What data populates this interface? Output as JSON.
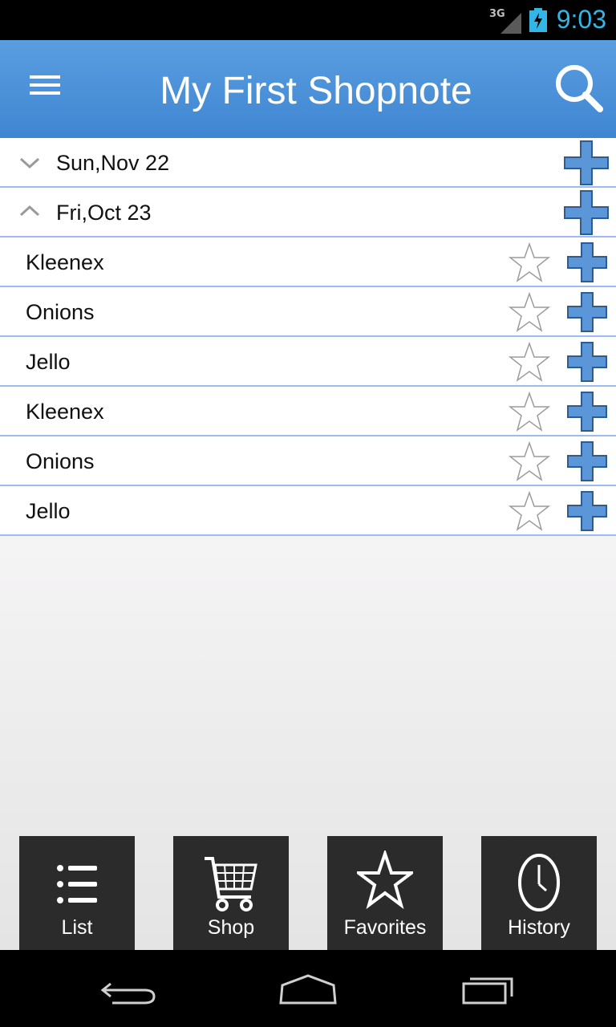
{
  "status_bar": {
    "network": "3G",
    "time": "9:03"
  },
  "app_bar": {
    "title": "My First Shopnote",
    "menu_icon": "hamburger-menu-icon",
    "search_icon": "search-icon"
  },
  "colors": {
    "accent": "#3f86d2",
    "plus": "#5a96d8",
    "divider": "#9bbcf0",
    "clock": "#33b5e5"
  },
  "groups": [
    {
      "label": "Sun,Nov 22",
      "expanded": false
    },
    {
      "label": "Fri,Oct 23",
      "expanded": true
    }
  ],
  "items": [
    {
      "label": "Kleenex",
      "favorite": false
    },
    {
      "label": "Onions",
      "favorite": false
    },
    {
      "label": "Jello",
      "favorite": false
    },
    {
      "label": "Kleenex",
      "favorite": false
    },
    {
      "label": "Onions",
      "favorite": false
    },
    {
      "label": "Jello",
      "favorite": false
    }
  ],
  "tabs": [
    {
      "label": "List",
      "icon": "list-icon"
    },
    {
      "label": "Shop",
      "icon": "cart-icon"
    },
    {
      "label": "Favorites",
      "icon": "star-icon"
    },
    {
      "label": "History",
      "icon": "clock-icon"
    }
  ],
  "nav": {
    "back_icon": "back-icon",
    "home_icon": "home-icon",
    "recents_icon": "recents-icon"
  }
}
